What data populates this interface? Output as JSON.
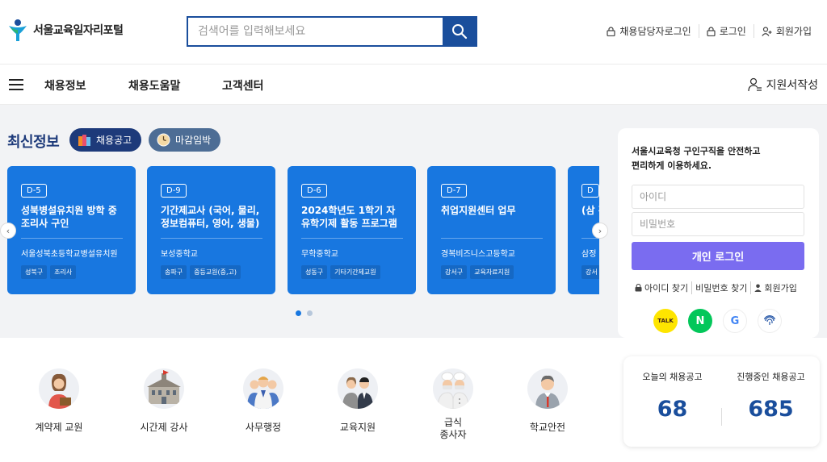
{
  "header": {
    "logo_text": "서울교육일자리포털",
    "search_placeholder": "검색어를 입력해보세요",
    "links": [
      {
        "label": "채용담당자로그인",
        "icon": "lock-icon"
      },
      {
        "label": "로그인",
        "icon": "lock-icon"
      },
      {
        "label": "회원가입",
        "icon": "user-plus-icon"
      }
    ]
  },
  "nav": {
    "items": [
      "채용정보",
      "채용도움말",
      "고객센터"
    ],
    "right_label": "지원서작성"
  },
  "latest": {
    "title": "최신정보",
    "tab_jobs": "채용공고",
    "tab_deadline": "마감임박",
    "cards": [
      {
        "dday": "D-5",
        "title": "성북병설유치원 방학 중 조리사 구인",
        "school": "서울성북초등학교병설유치원",
        "tags": [
          "성북구",
          "조리사"
        ]
      },
      {
        "dday": "D-9",
        "title": "기간제교사 (국어, 물리, 정보컴퓨터, 영어, 생물)",
        "school": "보성중학교",
        "tags": [
          "송파구",
          "중등교원(중,고)"
        ]
      },
      {
        "dday": "D-6",
        "title": "2024학년도 1학기 자유학기제 활동 프로그램 …",
        "school": "무학중학교",
        "tags": [
          "성동구",
          "기타기간제교원"
        ]
      },
      {
        "dday": "D-7",
        "title": "취업지원센터 업무",
        "school": "경복비즈니스고등학교",
        "tags": [
          "강서구",
          "교육자료지원"
        ]
      },
      {
        "dday": "D",
        "title": "(삼 간",
        "school": "삼정",
        "tags": [
          "강서"
        ]
      }
    ]
  },
  "login": {
    "desc_line1": "서울시교육청 구인구직을 안전하고",
    "desc_line2": "편리하게 이용하세요.",
    "id_placeholder": "아이디",
    "pw_placeholder": "비밀번호",
    "button": "개인 로그인",
    "find_id": "아이디 찾기",
    "find_pw": "비밀번호 찾기",
    "signup": "회원가입",
    "sns": [
      {
        "name": "kakao",
        "label": "TALK",
        "color": "#fee500"
      },
      {
        "name": "naver",
        "label": "N",
        "color": "#03c75a"
      },
      {
        "name": "google",
        "label": "G",
        "color": "#ffffff"
      },
      {
        "name": "fingerprint",
        "label": "",
        "color": "#ffffff"
      }
    ]
  },
  "categories": [
    {
      "label": "계약제 교원",
      "icon": "teacher-icon"
    },
    {
      "label": "시간제 강사",
      "icon": "school-building-icon"
    },
    {
      "label": "사무행정",
      "icon": "office-staff-icon"
    },
    {
      "label": "교육지원",
      "icon": "education-support-icon"
    },
    {
      "label": "급식\n종사자",
      "icon": "cook-icon"
    },
    {
      "label": "학교안전",
      "icon": "security-guard-icon"
    }
  ],
  "stats": {
    "today_label": "오늘의 채용공고",
    "today_value": "68",
    "ongoing_label": "진행중인 채용공고",
    "ongoing_value": "685"
  },
  "colors": {
    "brand_navy": "#1a4e9c",
    "card_blue": "#1877e0",
    "login_purple": "#7a6cf0"
  }
}
